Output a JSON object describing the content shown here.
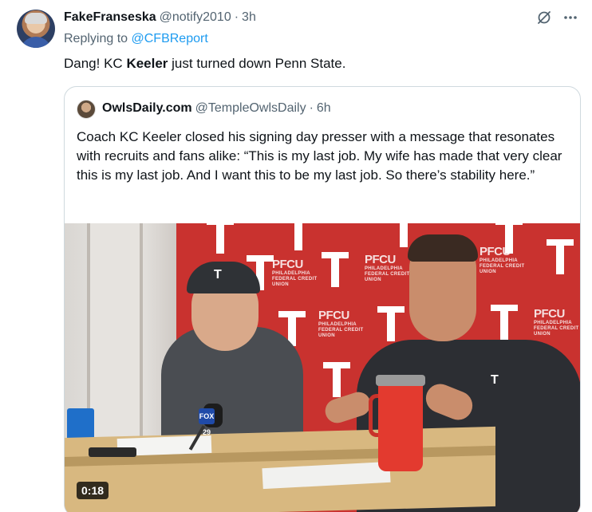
{
  "tweet": {
    "display_name": "FakeFranseska",
    "handle": "@notify2010",
    "separator": "·",
    "time": "3h",
    "replying_prefix": "Replying to",
    "replying_to": "@CFBReport",
    "text_before": "Dang! KC ",
    "text_bold": "Keeler",
    "text_after": " just turned down Penn State."
  },
  "quote": {
    "display_name": "OwlsDaily.com",
    "handle": "@TempleOwlsDaily",
    "separator": "·",
    "time": "6h",
    "text": "Coach KC Keeler closed his signing day presser with a message that resonates with recruits and fans alike: “This is my last job.  My wife has made that very clear this is my last job.  And I want this to be my last job.  So there’s stability here.”",
    "video_duration": "0:18",
    "mic_flag": "FOX 29",
    "sponsor_name": "PFCU",
    "sponsor_caption": "PHILADELPHIA FEDERAL CREDIT UNION"
  },
  "icons": {
    "grok": "grok-icon",
    "more": "more-icon"
  },
  "colors": {
    "link": "#1d9bf0",
    "muted": "#536471",
    "text": "#0f1419",
    "border": "#cfd9de",
    "backdrop_red": "#c9322f"
  }
}
